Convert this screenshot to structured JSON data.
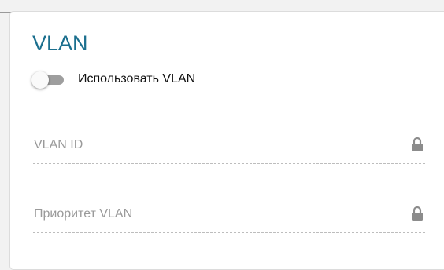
{
  "section": {
    "title": "VLAN"
  },
  "use_vlan": {
    "label": "Использовать VLAN",
    "enabled": false
  },
  "fields": {
    "vlan_id": {
      "placeholder": "VLAN ID",
      "value": "",
      "locked": true,
      "icon": "lock-icon"
    },
    "vlan_priority": {
      "placeholder": "Приоритет VLAN",
      "value": "",
      "locked": true,
      "icon": "lock-icon"
    }
  },
  "colors": {
    "title": "#1b6f8e",
    "toggle_off_track": "#9e9e9e",
    "placeholder_text": "#9a9a9a",
    "lock_icon": "#8c8c8c"
  }
}
